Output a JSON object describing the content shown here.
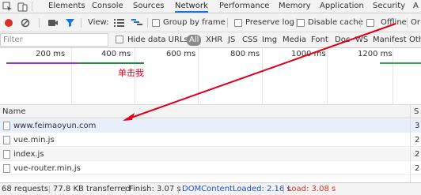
{
  "tabs": [
    {
      "label": "Elements"
    },
    {
      "label": "Console"
    },
    {
      "label": "Sources"
    },
    {
      "label": "Network",
      "active": true
    },
    {
      "label": "Performance"
    },
    {
      "label": "Memory"
    },
    {
      "label": "Application"
    },
    {
      "label": "Security"
    },
    {
      "label": "A"
    }
  ],
  "toolbar": {
    "view_label": "View:",
    "group_by_frame": "Group by frame",
    "preserve_log": "Preserve log",
    "disable_cache": "Disable cache",
    "offline": "Offline",
    "throttle_partial": "Or"
  },
  "filter": {
    "placeholder": "Filter",
    "hide_data_urls": "Hide data URLs",
    "types": [
      "All",
      "XHR",
      "JS",
      "CSS",
      "Img",
      "Media",
      "Font",
      "Doc",
      "WS",
      "Manifest",
      "Oth"
    ]
  },
  "overview": {
    "ticks": [
      "200 ms",
      "400 ms",
      "600 ms",
      "800 ms",
      "1000 ms",
      "1200 ms"
    ],
    "annotation": "单击我"
  },
  "table": {
    "col_name": "Name",
    "col_status": "S",
    "rows": [
      {
        "name": "www.feimaoyun.com",
        "size": "3"
      },
      {
        "name": "vue.min.js",
        "size": "2"
      },
      {
        "name": "index.js",
        "size": "2"
      },
      {
        "name": "vue-router.min.js",
        "size": "2"
      }
    ]
  },
  "status": {
    "requests": "68 requests",
    "transferred": "77.8 KB transferred",
    "finish": "Finish: 3.07 s",
    "dom_content_loaded": "DOMContentLoaded: 2.16 s",
    "load": "Load: 3.08 s"
  },
  "colors": {
    "record": "#d93025",
    "accent": "#1a73e8",
    "dcl": "#1a50c8",
    "load": "#d93025",
    "annotation": "#e0001b"
  }
}
